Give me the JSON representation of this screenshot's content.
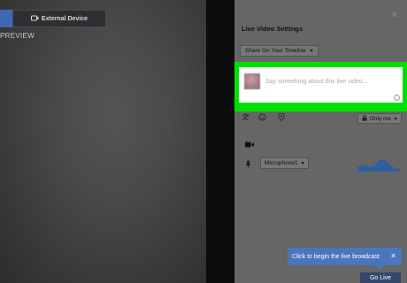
{
  "source": {
    "camera_tab_label": "",
    "external_device_label": "External Device",
    "preview_label": "PREVIEW"
  },
  "panel": {
    "title": "Live Video Settings",
    "close_glyph": "✕",
    "share_dropdown": "Share On Your Timeline",
    "compose_placeholder": "Say something about this live video...",
    "privacy_label": "Only me",
    "microphone_label": "Microphone1"
  },
  "tooltip": {
    "text": "Click to begin the live broadcast",
    "close_glyph": "✕"
  },
  "go_live_label": "Go Live",
  "colors": {
    "highlight": "#00e000",
    "brand_blue": "#4267b2",
    "tooltip_blue": "#4a76bd"
  },
  "icons": [
    "external-device-icon",
    "tag-people-icon",
    "emoji-icon",
    "location-icon",
    "lock-icon",
    "video-camera-icon",
    "microphone-icon"
  ]
}
